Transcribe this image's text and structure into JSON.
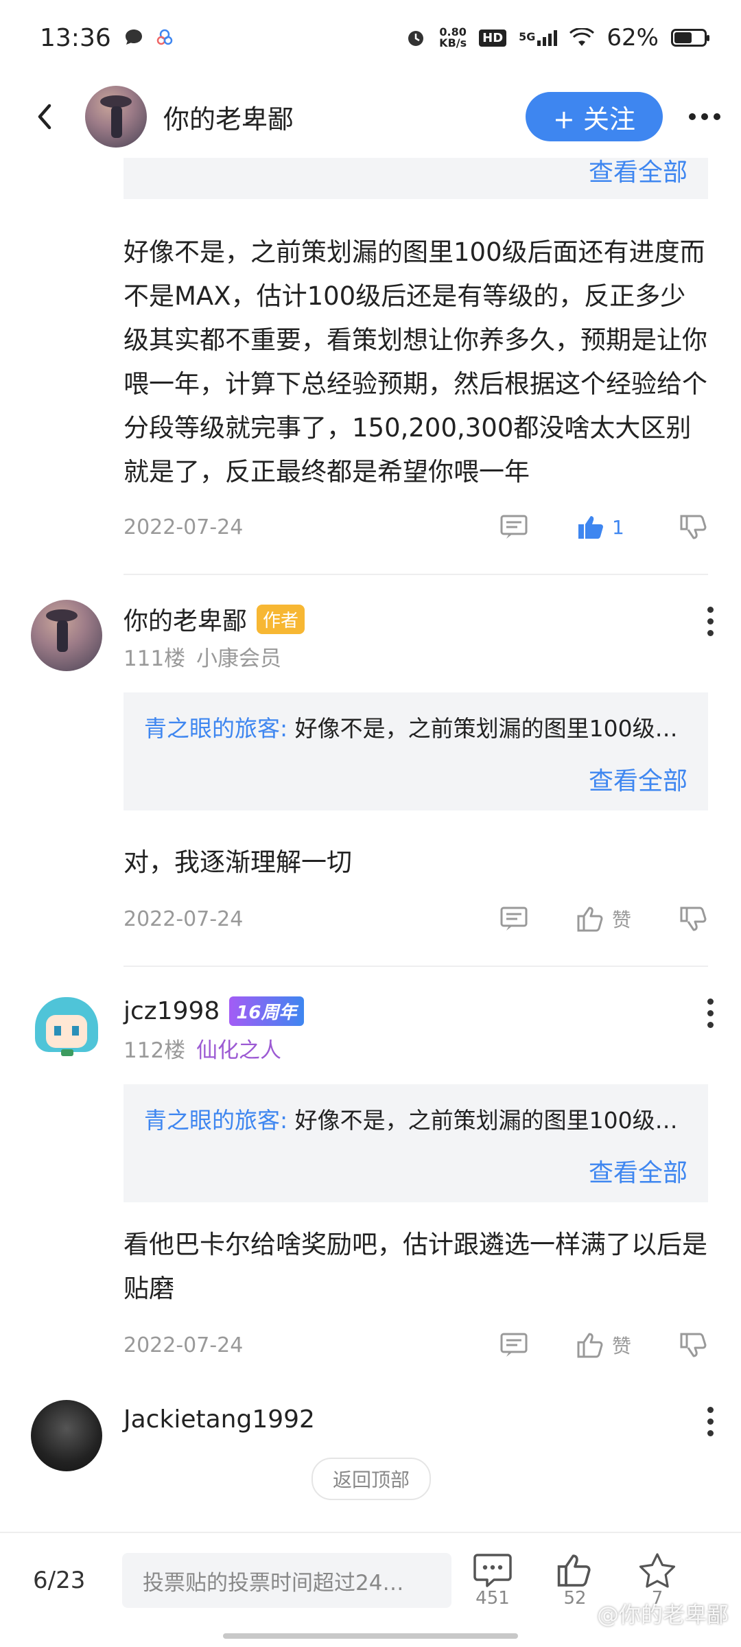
{
  "status_bar": {
    "time": "13:36",
    "net_speed_top": "0.80",
    "net_speed_unit": "KB/s",
    "hd": "HD",
    "signal": "5G",
    "battery": "62%"
  },
  "topbar": {
    "title": "你的老卑鄙",
    "follow_label": "+ 关注"
  },
  "top_quote": {
    "view_all": "查看全部"
  },
  "reply1": {
    "text": "好像不是，之前策划漏的图里100级后面还有进度而不是MAX，估计100级后还是有等级的，反正多少级其实都不重要，看策划想让你养多久，预期是让你喂一年，计算下总经验预期，然后根据这个经验给个分段等级就完事了，150,200,300都没啥太大区别就是了，反正最终都是希望你喂一年",
    "date": "2022-07-24",
    "like_count": "1"
  },
  "floor111": {
    "name": "你的老卑鄙",
    "badge": "作者",
    "floor": "111楼",
    "rank": "小康会员",
    "quote_user": "青之眼的旅客:",
    "quote_text": " 好像不是，之前策划漏的图里100级…",
    "view_all": "查看全部",
    "text": "对，我逐渐理解一切",
    "date": "2022-07-24",
    "like_label": "赞"
  },
  "floor112": {
    "name": "jcz1998",
    "badge": "16周年",
    "floor": "112楼",
    "rank": "仙化之人",
    "quote_user": "青之眼的旅客:",
    "quote_text": " 好像不是，之前策划漏的图里100级…",
    "view_all": "查看全部",
    "text": "看他巴卡尔给啥奖励吧，估计跟遴选一样满了以后是贴磨",
    "date": "2022-07-24",
    "like_label": "赞"
  },
  "floor113": {
    "name": "Jackietang1992"
  },
  "back_to_top": "返回顶部",
  "bottom_bar": {
    "page": "6/23",
    "input_placeholder": "投票贴的投票时间超过24…",
    "comments": "451",
    "likes": "52",
    "favorites": "7"
  },
  "watermark": "@你的老卑鄙",
  "colors": {
    "accent": "#3e86f0",
    "author_badge": "#f7b733",
    "rank_purple": "#9c5ad3"
  },
  "icons": [
    "back-icon",
    "more-icon",
    "comment-icon",
    "thumb-up-icon",
    "thumb-down-icon",
    "star-icon",
    "kebab-icon"
  ]
}
